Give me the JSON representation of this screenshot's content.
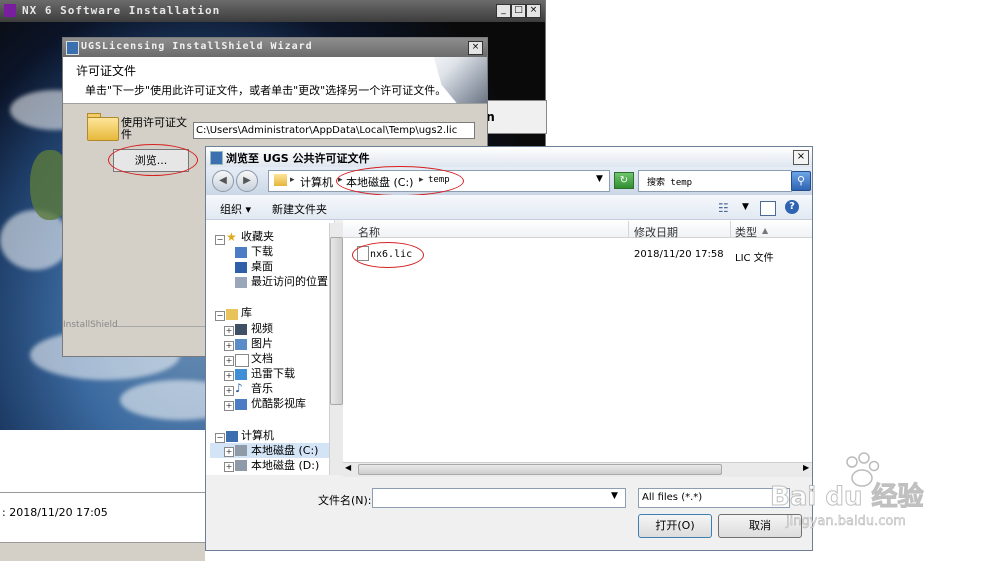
{
  "nx_window": {
    "title": "NX 6 Software Installation",
    "side_button": "on",
    "status_line": ": 2018/11/20 17:05"
  },
  "wizard": {
    "title": "UGSLicensing InstallShield Wizard",
    "header_title": "许可证文件",
    "header_desc": "单击\"下一步\"使用此许可证文件，或者单击\"更改\"选择另一个许可证文件。",
    "license_label": "使用许可证文件",
    "license_path": "C:\\Users\\Administrator\\AppData\\Local\\Temp\\ugs2.lic",
    "browse_button": "浏览...",
    "footer": "InstallShield"
  },
  "dialog": {
    "title": "浏览至 UGS 公共许可证文件",
    "address": {
      "crumbs": [
        "计算机",
        "本地磁盘 (C:)",
        "temp"
      ]
    },
    "search_placeholder": "搜索 temp",
    "toolbar": {
      "organize": "组织",
      "new_folder": "新建文件夹"
    },
    "nav_tree": {
      "favorites": {
        "label": "收藏夹",
        "items": [
          "下载",
          "桌面",
          "最近访问的位置"
        ]
      },
      "libraries": {
        "label": "库",
        "items": [
          "视频",
          "图片",
          "文档",
          "迅雷下载",
          "音乐",
          "优酷影视库"
        ]
      },
      "computer": {
        "label": "计算机",
        "items": [
          "本地磁盘 (C:)",
          "本地磁盘 (D:)"
        ]
      }
    },
    "columns": {
      "name": "名称",
      "date": "修改日期",
      "type": "类型"
    },
    "files": [
      {
        "name": "nx6.lic",
        "date": "2018/11/20 17:58",
        "type": "LIC 文件"
      }
    ],
    "filename_label": "文件名(N):",
    "filename_value": "",
    "filetype_value": "All files (*.*)",
    "open_button": "打开(O)",
    "cancel_button": "取消"
  },
  "watermark": {
    "brand": "Bai du 经验",
    "url": "jingyan.baidu.com"
  },
  "colors": {
    "annotation_red": "#d62020",
    "dialog_frame": "#6d7f96"
  }
}
